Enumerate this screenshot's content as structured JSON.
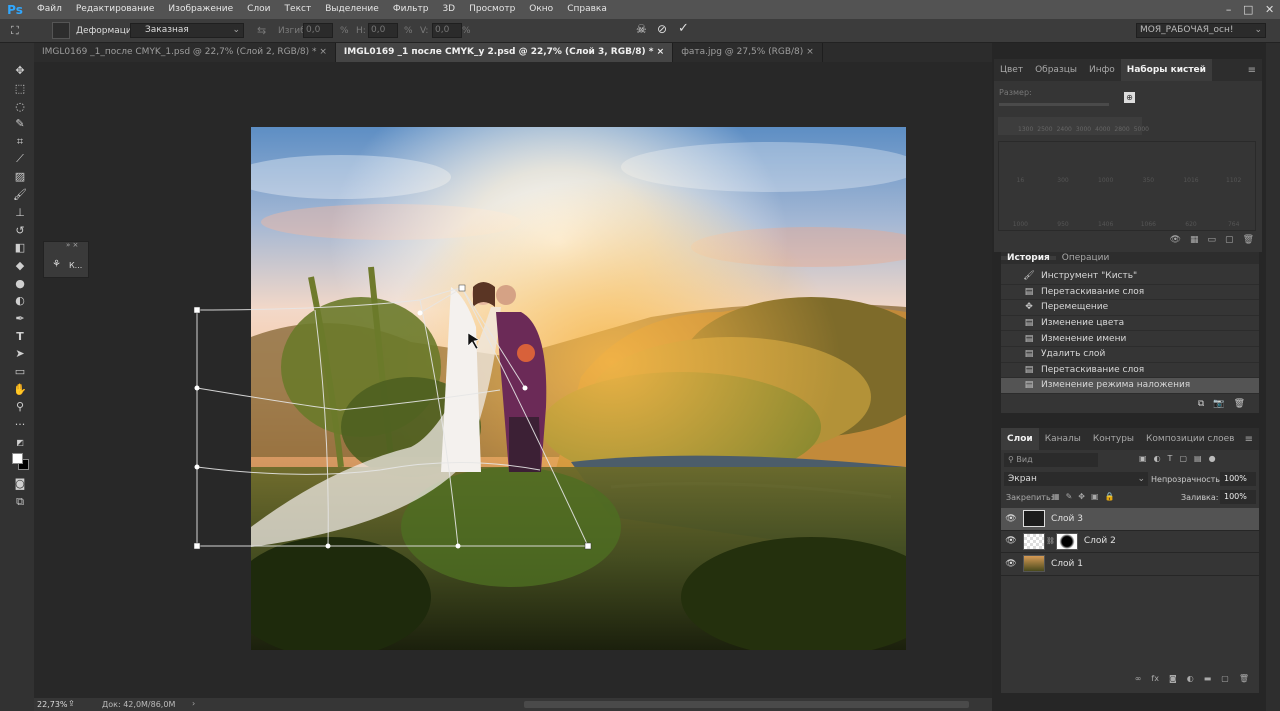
{
  "app": {
    "logo": "Ps"
  },
  "menu": [
    "Файл",
    "Редактирование",
    "Изображение",
    "Слои",
    "Текст",
    "Выделение",
    "Фильтр",
    "3D",
    "Просмотр",
    "Окно",
    "Справка"
  ],
  "options": {
    "warp_label": "Деформация:",
    "warp_value": "Заказная",
    "bend_label": "Изгиб:",
    "bend_value": "0,0",
    "pct": "%",
    "h_label": "H:",
    "h_value": "0,0",
    "v_label": "V:",
    "v_value": "0,0",
    "workspace": "МОЯ_РАБОЧАЯ_осн!"
  },
  "tabs": [
    {
      "label": "IMGL0169 _1_после CMYK_1.psd @ 22,7% (Слой 2, RGB/8) *"
    },
    {
      "label": "IMGL0169 _1 после CMYK_у 2.psd @ 22,7% (Слой 3, RGB/8) *"
    },
    {
      "label": "фата.jpg @ 27,5% (RGB/8)"
    }
  ],
  "mini_panel": {
    "label": "К..."
  },
  "brush_panel": {
    "tabs": [
      "Цвет",
      "Образцы",
      "Инфо",
      "Наборы кистей"
    ],
    "size_label": "Размер:",
    "row1": [
      "1300",
      "2500",
      "2400",
      "3000",
      "4000",
      "2800",
      "5000"
    ],
    "grid_labels": [
      "16",
      "300",
      "1000",
      "350",
      "1016",
      "1102",
      "1000",
      "950",
      "1406",
      "1066",
      "620",
      "764"
    ]
  },
  "history_panel": {
    "tabs": [
      "История",
      "Операции"
    ],
    "items": [
      {
        "icon": "brush-icon",
        "label": "Инструмент \"Кисть\""
      },
      {
        "icon": "doc-icon",
        "label": "Перетаскивание слоя"
      },
      {
        "icon": "move-icon",
        "label": "Перемещение"
      },
      {
        "icon": "doc-icon",
        "label": "Изменение цвета"
      },
      {
        "icon": "doc-icon",
        "label": "Изменение имени"
      },
      {
        "icon": "doc-icon",
        "label": "Удалить слой"
      },
      {
        "icon": "doc-icon",
        "label": "Перетаскивание слоя"
      },
      {
        "icon": "doc-icon",
        "label": "Изменение режима наложения"
      }
    ]
  },
  "layers_panel": {
    "tabs": [
      "Слои",
      "Каналы",
      "Контуры",
      "Композиции слоев"
    ],
    "filter_label": "Вид",
    "blend_mode": "Экран",
    "opacity_label": "Непрозрачность:",
    "opacity_value": "100%",
    "lock_label": "Закрепить:",
    "fill_label": "Заливка:",
    "fill_value": "100%",
    "layers": [
      {
        "name": "Слой 3"
      },
      {
        "name": "Слой 2"
      },
      {
        "name": "Слой 1"
      }
    ]
  },
  "status": {
    "zoom": "22,73%",
    "doc": "Док: 42,0M/86,0M"
  }
}
